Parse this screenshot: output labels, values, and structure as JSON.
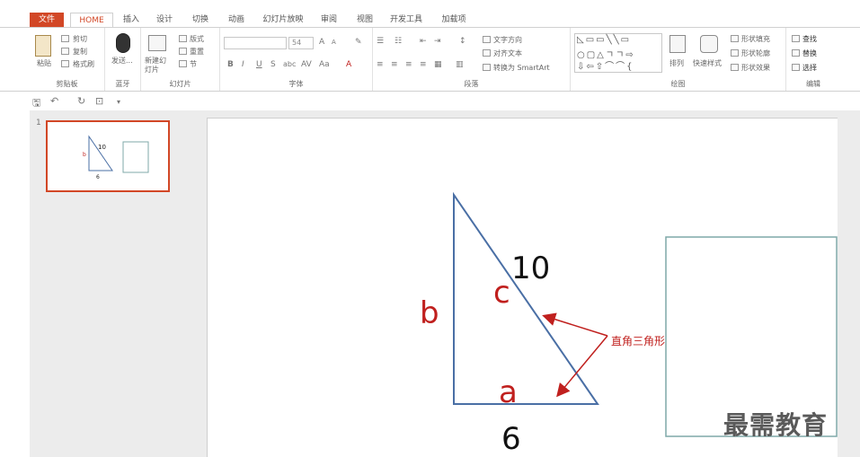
{
  "tabs": [
    {
      "label": "文件"
    },
    {
      "label": "HOME"
    },
    {
      "label": "插入"
    },
    {
      "label": "设计"
    },
    {
      "label": "切换"
    },
    {
      "label": "动画"
    },
    {
      "label": "幻灯片放映"
    },
    {
      "label": "审阅"
    },
    {
      "label": "视图"
    },
    {
      "label": "开发工具"
    },
    {
      "label": "加载项"
    }
  ],
  "ribbon": {
    "clipboard": {
      "paste": "粘贴",
      "cut": "剪切",
      "copy": "复制",
      "format_painter": "格式刷",
      "group": "剪贴板"
    },
    "bluetooth": {
      "send": "发送...",
      "group": "蓝牙"
    },
    "slides": {
      "new_slide": "新建幻灯片",
      "layout": "版式",
      "reset": "重置",
      "section": "节",
      "group": "幻灯片"
    },
    "font": {
      "size": "54",
      "bold": "B",
      "italic": "I",
      "underline": "U",
      "strike": "S",
      "abc": "abc",
      "aa": "Aa",
      "group": "字体"
    },
    "paragraph": {
      "text_direction": "文字方向",
      "align_text": "对齐文本",
      "smartart": "转换为 SmartArt",
      "group": "段落"
    },
    "drawing": {
      "arrange": "排列",
      "quick_styles": "快速样式",
      "shape_fill": "形状填充",
      "shape_outline": "形状轮廓",
      "shape_effects": "形状效果",
      "group": "绘图"
    },
    "editing": {
      "find": "查找",
      "replace": "替换",
      "select": "选择",
      "group": "编辑"
    }
  },
  "thumbnail": {
    "number": "1",
    "labels": {
      "hyp": "10",
      "b": "b",
      "bottom": "6"
    }
  },
  "slide": {
    "label_b": "b",
    "label_c": "c",
    "label_a": "a",
    "hyp_value": "10",
    "base_value": "6",
    "annotation": "直角三角形",
    "colors": {
      "triangle": "#4a6fa5",
      "red": "#c0201e",
      "box": "#7fa8a8"
    }
  },
  "watermark": "最需教育"
}
